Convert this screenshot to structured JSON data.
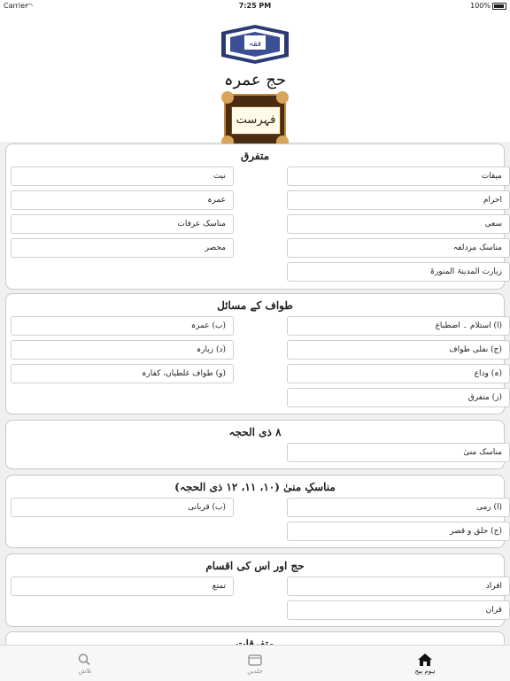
{
  "status_bar": {
    "carrier": "Carrier",
    "time": "7:25 PM",
    "battery": "100%"
  },
  "header": {
    "logo_text": "حج عمرہ",
    "badge_text": "فہرست"
  },
  "sections": [
    {
      "title": "متفرق",
      "right": [
        "میقات",
        "احرام",
        "سعی",
        "مناسک مزدلفہ",
        "زیارت المدینۃ المنورۃ"
      ],
      "left": [
        "نیت",
        "عمرہ",
        "مناسک عرفات",
        "محصر"
      ]
    },
    {
      "title": "طواف کے مسائل",
      "right": [
        "(ا) استلام ۔ اضطباع",
        "(ج) نفلی طواف",
        "(ہ) وداع",
        "(ز) متفرق"
      ],
      "left": [
        "(ب) عمرہ",
        "(د) زیارہ",
        "(و) طواف غلطیاں، کفارہ"
      ]
    },
    {
      "title": "۸ ذی الحجہ",
      "right": [
        "مناسک منیٰ"
      ],
      "left": []
    },
    {
      "title": "مناسکِ منیٰ (۱۰، ۱۱، ۱۲ ذی الحجہ)",
      "right": [
        "(ا) رمی",
        "(ج) حلق و قصر"
      ],
      "left": [
        "(ب) قربانی"
      ]
    },
    {
      "title": "حج اور اس کی اقسام",
      "right": [
        "افراد",
        "قران"
      ],
      "left": [
        "تمتع"
      ]
    },
    {
      "title": "متفرقات",
      "right": [],
      "left": []
    }
  ],
  "tabs": [
    {
      "label": "تلاش",
      "icon": "search-icon"
    },
    {
      "label": "جلدیں",
      "icon": "volumes-icon"
    },
    {
      "label": "ہوم پیج",
      "icon": "home-icon"
    }
  ]
}
